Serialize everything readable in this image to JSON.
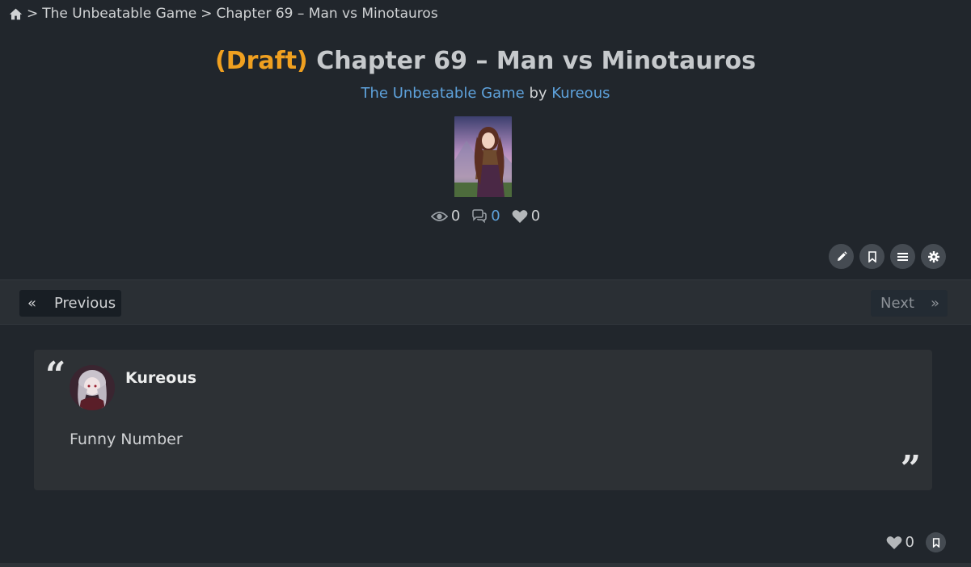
{
  "breadcrumb": {
    "home_icon": "home-icon",
    "separator": ">",
    "items": [
      "The Unbeatable Game",
      "Chapter 69 – Man vs Minotauros"
    ]
  },
  "chapter": {
    "draft_label": "(Draft)",
    "title": "Chapter 69 – Man vs Minotauros",
    "story": "The Unbeatable Game",
    "by": "by",
    "author": "Kureous"
  },
  "stats": {
    "views": "0",
    "comments": "0",
    "likes": "0"
  },
  "tools": [
    "edit-icon",
    "bookmark-icon",
    "list-icon",
    "settings-icon"
  ],
  "nav": {
    "prev_arrow": "«",
    "prev_label": "Previous",
    "next_label": "Next",
    "next_arrow": "»"
  },
  "note": {
    "author": "Kureous",
    "text": "Funny Number",
    "open_quote": "“",
    "close_quote": "”"
  },
  "footer": {
    "likes": "0"
  },
  "colors": {
    "background": "#21262c",
    "draft": "#f0a020",
    "link": "#5ea2dc"
  }
}
